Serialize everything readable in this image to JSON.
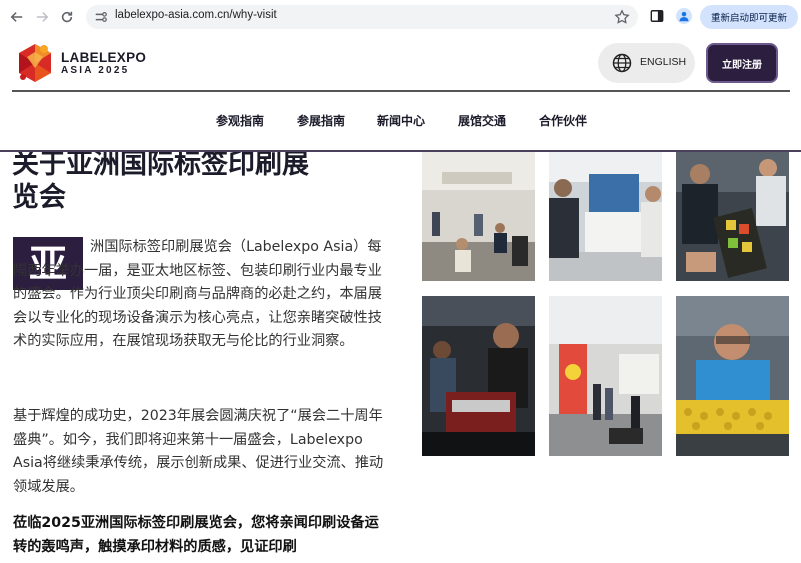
{
  "browser": {
    "url": "labelexpo-asia.com.cn/why-visit",
    "relaunch_label": "重新启动即可更新",
    "icons": [
      "back-arrow-icon",
      "forward-arrow-icon",
      "reload-icon",
      "site-info-icon",
      "bookmark-star-icon",
      "side-panel-icon",
      "profile-icon"
    ]
  },
  "header": {
    "logo_line1": "LABELEXPO",
    "logo_line2": "ASIA 2025",
    "language_label": "ENGLISH",
    "register_label": "立即注册",
    "nav": [
      "参观指南",
      "参展指南",
      "新闻中心",
      "展馆交通",
      "合作伙伴"
    ]
  },
  "content": {
    "heading": "关于亚洲国际标签印刷展览会",
    "dropcap": "亚",
    "para1": "洲国际标签印刷展览会（Labelexpo Asia）每隔两年举办一届，是亚太地区标签、包装印刷行业内最专业的盛会。作为行业顶尖印刷商与品牌商的必赴之约，本届展会以专业化的现场设备演示为核心亮点，让您亲睹突破性技术的实际应用，在展馆现场获取无与伦比的行业洞察。",
    "para2": "基于辉煌的成功史，2023年展会圆满庆祝了“展会二十周年盛典”。如今，我们即将迎来第十一届盛会，Labelexpo Asia将继续秉承传统，展示创新成果、促进行业交流、推动领域发展。",
    "para3": "莅临2025亚洲国际标签印刷展览会，您将亲闻印刷设备运转的轰鸣声，触摸承印材料的质感，见证印刷"
  },
  "colors": {
    "brand_dark": "#2c1e3f",
    "brand_border": "#6d5a8e",
    "chrome_pill": "#d3e3fd"
  }
}
